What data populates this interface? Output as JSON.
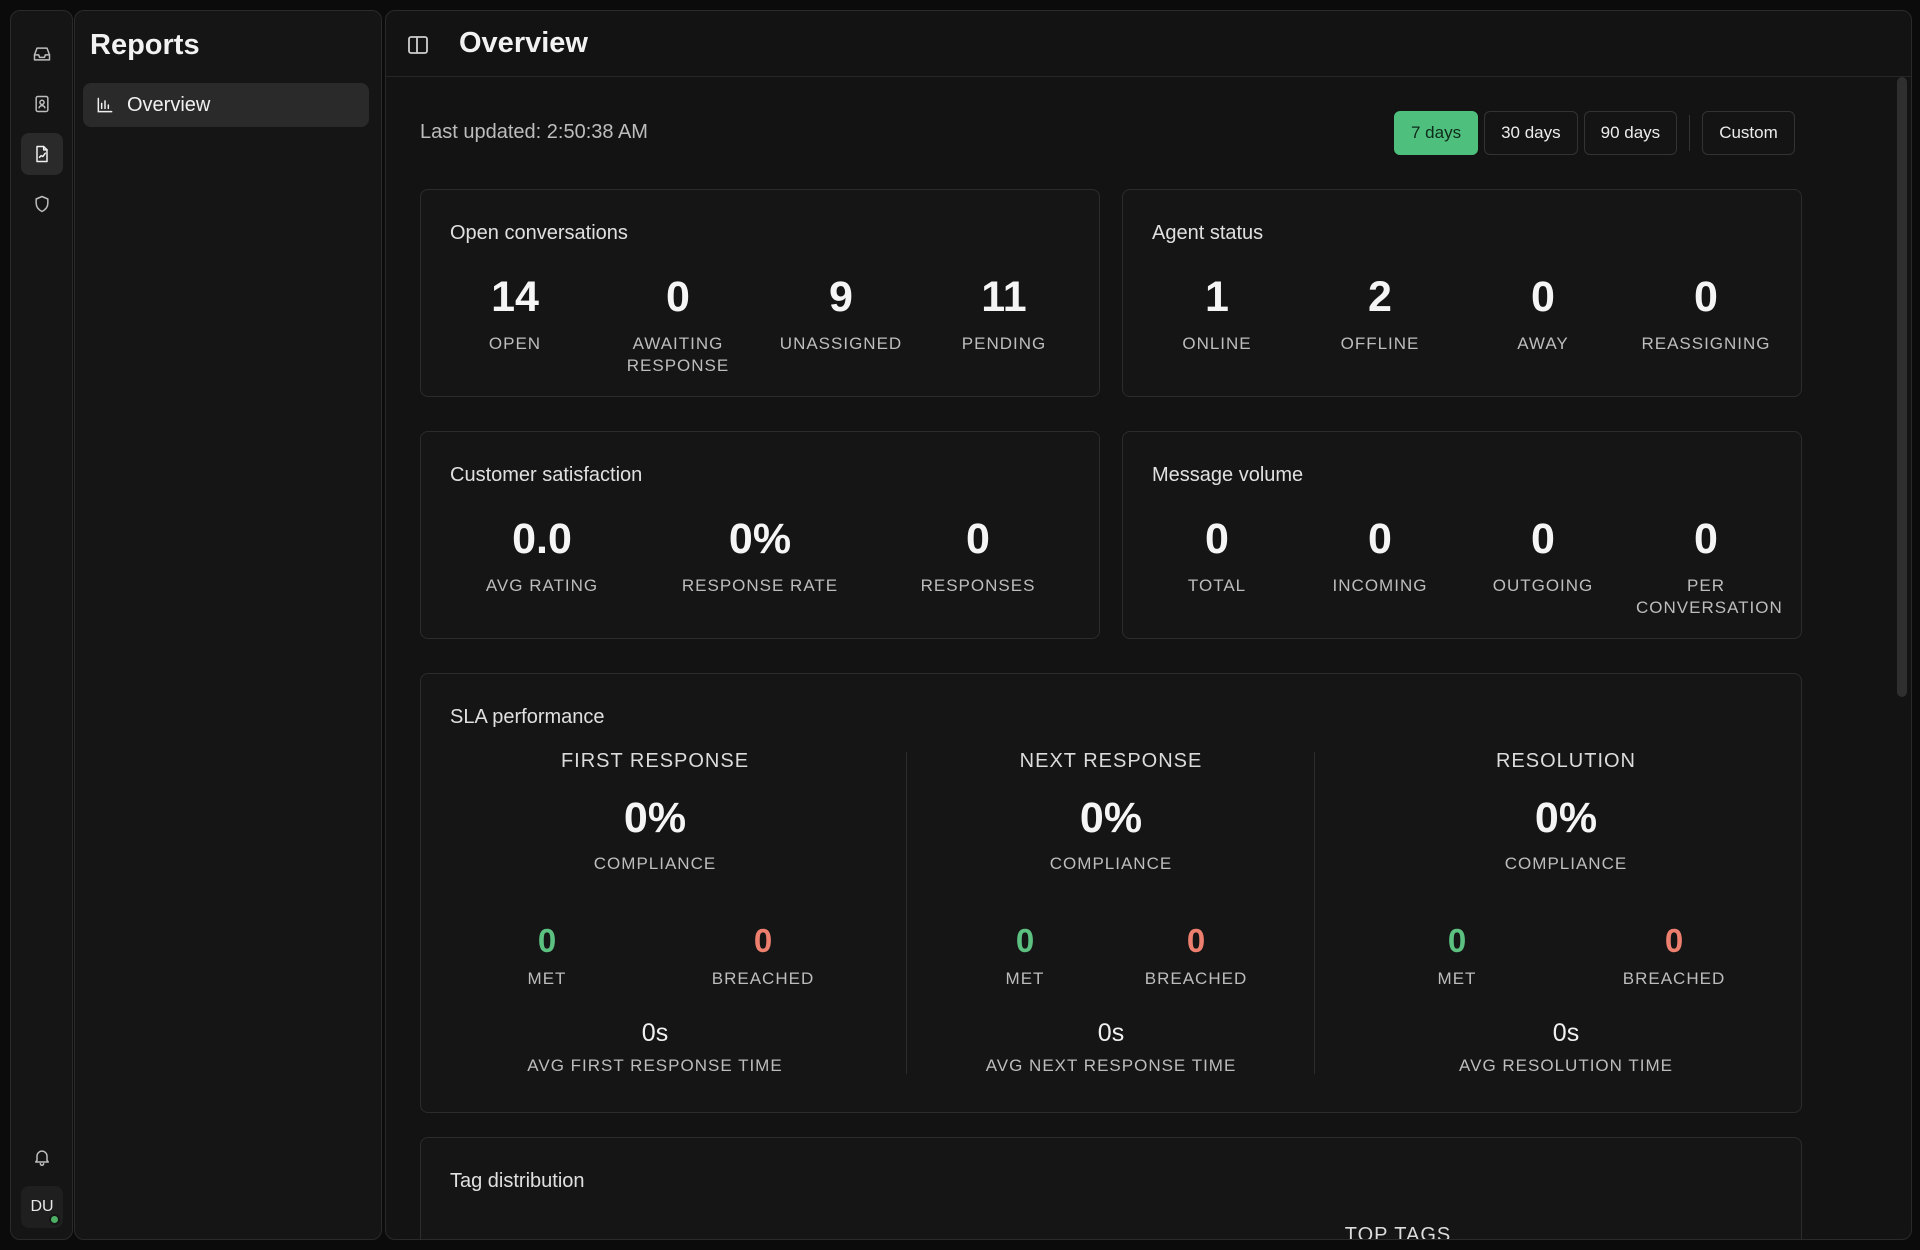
{
  "rail": {
    "items": [
      {
        "icon": "inbox-icon",
        "active": false
      },
      {
        "icon": "contacts-icon",
        "active": false
      },
      {
        "icon": "reports-icon",
        "active": true
      },
      {
        "icon": "shield-icon",
        "active": false
      }
    ],
    "bell_icon": "bell-icon",
    "avatar_initials": "DU",
    "status_color": "#4caf63"
  },
  "sidebar": {
    "title": "Reports",
    "items": [
      {
        "label": "Overview",
        "icon": "bar-chart-icon"
      }
    ]
  },
  "header": {
    "title": "Overview",
    "toggle_icon": "panel-toggle-icon"
  },
  "toolbar": {
    "last_updated": "Last updated: 2:50:38 AM",
    "ranges": [
      "7 days",
      "30 days",
      "90 days"
    ],
    "active_range": "7 days",
    "custom_label": "Custom",
    "accent_color": "#4fbf7d"
  },
  "open_conversations": {
    "title": "Open conversations",
    "stats": [
      {
        "value": "14",
        "label": "OPEN"
      },
      {
        "value": "0",
        "label": "AWAITING RESPONSE"
      },
      {
        "value": "9",
        "label": "UNASSIGNED"
      },
      {
        "value": "11",
        "label": "PENDING"
      }
    ]
  },
  "agent_status": {
    "title": "Agent status",
    "stats": [
      {
        "value": "1",
        "label": "ONLINE"
      },
      {
        "value": "2",
        "label": "OFFLINE"
      },
      {
        "value": "0",
        "label": "AWAY"
      },
      {
        "value": "0",
        "label": "REASSIGNING"
      }
    ]
  },
  "customer_satisfaction": {
    "title": "Customer satisfaction",
    "stats": [
      {
        "value": "0.0",
        "label": "AVG RATING"
      },
      {
        "value": "0%",
        "label": "RESPONSE RATE"
      },
      {
        "value": "0",
        "label": "RESPONSES"
      }
    ]
  },
  "message_volume": {
    "title": "Message volume",
    "stats": [
      {
        "value": "0",
        "label": "TOTAL"
      },
      {
        "value": "0",
        "label": "INCOMING"
      },
      {
        "value": "0",
        "label": "OUTGOING"
      },
      {
        "value": "0",
        "label": "PER CONVERSATION"
      }
    ]
  },
  "sla": {
    "title": "SLA performance",
    "columns": [
      {
        "heading": "FIRST RESPONSE",
        "compliance": "0%",
        "compliance_label": "COMPLIANCE",
        "met": "0",
        "met_label": "MET",
        "breached": "0",
        "breached_label": "BREACHED",
        "avg_time": "0s",
        "avg_label": "AVG FIRST RESPONSE TIME"
      },
      {
        "heading": "NEXT RESPONSE",
        "compliance": "0%",
        "compliance_label": "COMPLIANCE",
        "met": "0",
        "met_label": "MET",
        "breached": "0",
        "breached_label": "BREACHED",
        "avg_time": "0s",
        "avg_label": "AVG NEXT RESPONSE TIME"
      },
      {
        "heading": "RESOLUTION",
        "compliance": "0%",
        "compliance_label": "COMPLIANCE",
        "met": "0",
        "met_label": "MET",
        "breached": "0",
        "breached_label": "BREACHED",
        "avg_time": "0s",
        "avg_label": "AVG RESOLUTION TIME"
      }
    ],
    "met_color": "#5cc081",
    "breached_color": "#ec7f6e"
  },
  "tag_distribution": {
    "title": "Tag distribution",
    "top_tags_label": "TOP TAGS"
  }
}
